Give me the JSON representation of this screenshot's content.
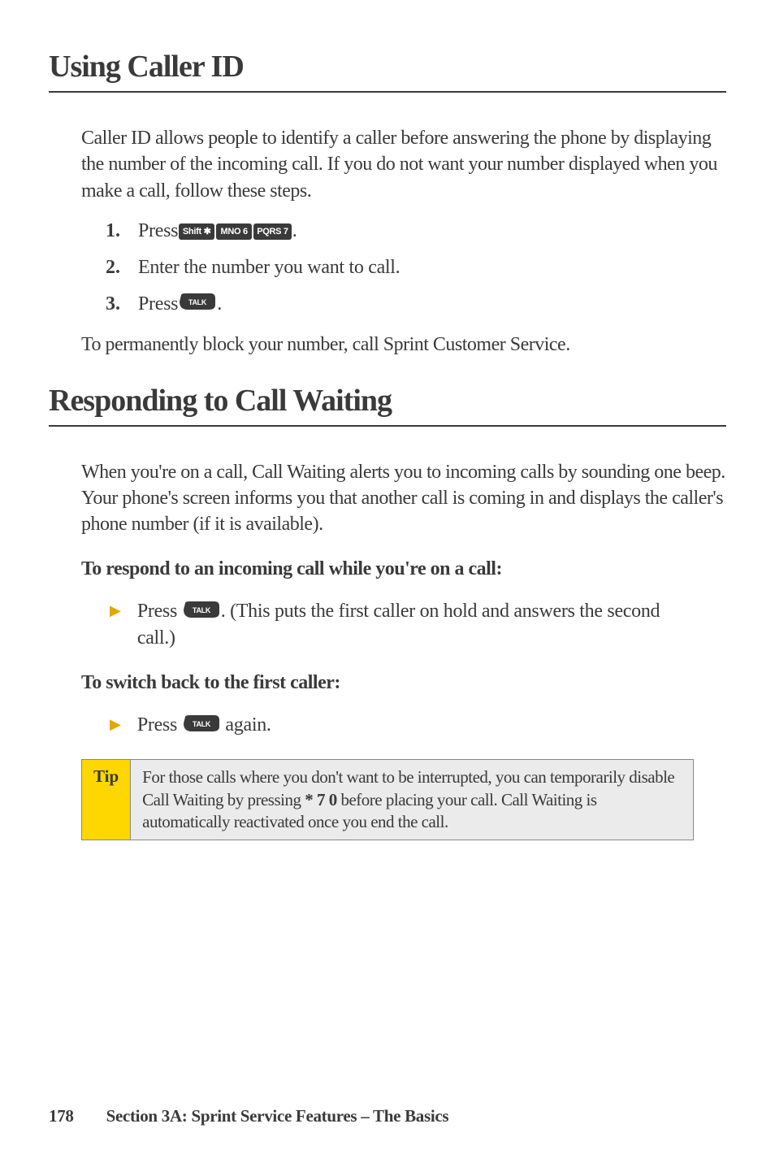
{
  "section1": {
    "title": "Using Caller ID",
    "intro": "Caller ID allows people to identify a caller before answering the phone by displaying the number of the incoming call. If you do not want your number displayed when you make a call, follow these steps.",
    "steps": {
      "s1": {
        "num": "1.",
        "prefix": "Press ",
        "suffix": "."
      },
      "s2": {
        "num": "2.",
        "text": "Enter the number you want to call."
      },
      "s3": {
        "num": "3.",
        "prefix": "Press ",
        "suffix": "."
      }
    },
    "outro": "To permanently block your number, call Sprint Customer Service."
  },
  "section2": {
    "title": "Responding to Call Waiting",
    "intro": "When you're on a call, Call Waiting alerts you to incoming calls by sounding one beep. Your phone's screen informs you that another call is coming in and displays the caller's phone number (if it is available).",
    "sub1": "To respond to an incoming call while you're on a call:",
    "bullet1": {
      "prefix": "Press ",
      "suffix": ". (This puts the first caller on hold and answers the second call.)"
    },
    "sub2": "To switch back to the first caller:",
    "bullet2": {
      "prefix": "Press ",
      "suffix": " again."
    }
  },
  "tip": {
    "label": "Tip",
    "pre": "For those calls where you don't want to be interrupted, you can temporarily disable Call Waiting by pressing ",
    "code": "* 7 0",
    "post": " before placing your call. Call Waiting is automatically reactivated once you end the call."
  },
  "keys": {
    "shift_star": "Shift ✱",
    "mno6": "MNO 6",
    "pqrs7": "PQRS 7",
    "talk": "TALK"
  },
  "footer": {
    "page": "178",
    "section": "Section 3A: Sprint Service Features – The Basics"
  }
}
